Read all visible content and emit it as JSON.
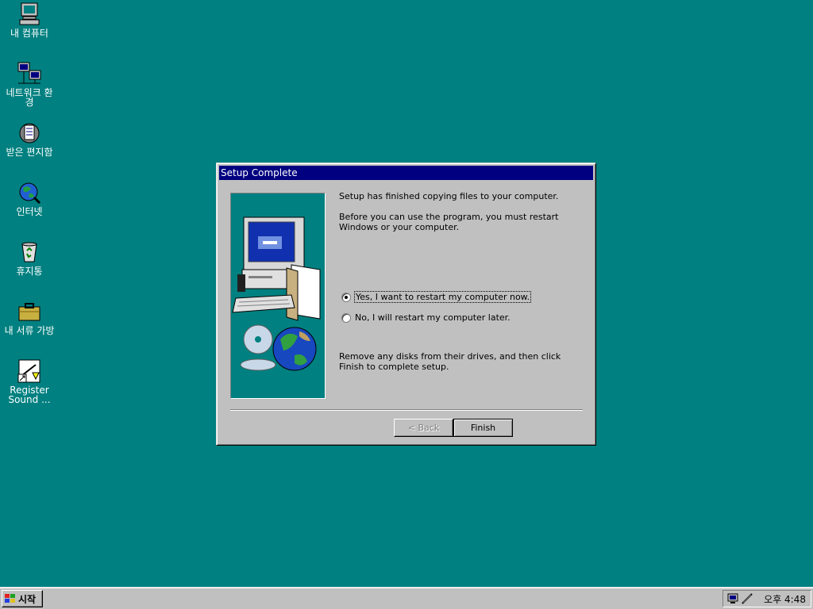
{
  "desktop": {
    "icons": [
      {
        "label": "내 컴퓨터",
        "icon": "my-computer-icon"
      },
      {
        "label": "네트워크 환경",
        "icon": "network-icon"
      },
      {
        "label": "받은 편지함",
        "icon": "inbox-icon"
      },
      {
        "label": "인터넷",
        "icon": "internet-icon"
      },
      {
        "label": "휴지통",
        "icon": "recycle-bin-icon"
      },
      {
        "label": "내 서류 가방",
        "icon": "briefcase-icon"
      },
      {
        "label": "Register Sound ...",
        "icon": "shortcut-icon"
      }
    ],
    "background": "#008080"
  },
  "dialog": {
    "title": "Setup Complete",
    "line1": "Setup has finished copying files to your computer.",
    "line2": "Before you can use the program, you must restart Windows or your computer.",
    "radio_yes": "Yes, I want to restart my computer now.",
    "radio_no": "No, I will restart my computer later.",
    "selected": "yes",
    "line3": "Remove any disks from their drives, and then click Finish to complete setup.",
    "back_label": "< Back",
    "finish_label": "Finish"
  },
  "taskbar": {
    "start_label": "시작",
    "clock": "오후 4:48"
  }
}
